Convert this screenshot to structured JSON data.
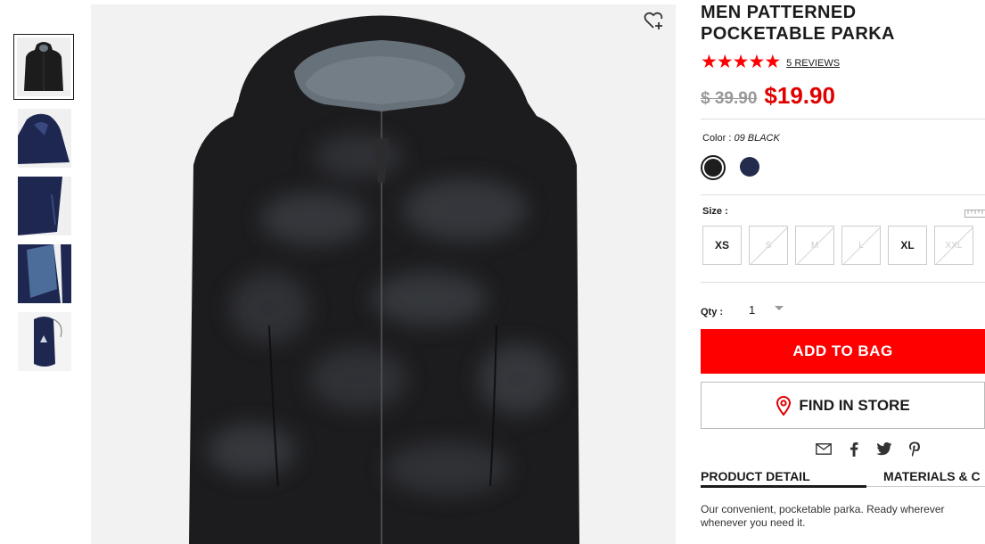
{
  "product": {
    "title": "MEN PATTERNED POCKETABLE PARKA",
    "rating_stars": 5,
    "reviews_label": "5 REVIEWS",
    "original_price": "$ 39.90",
    "sale_price": "$19.90"
  },
  "color": {
    "label": "Color :",
    "selected": "09 BLACK",
    "options": [
      {
        "name": "black",
        "hex": "#1e1e1e"
      },
      {
        "name": "navy",
        "hex": "#242c4d"
      }
    ]
  },
  "size": {
    "label": "Size :",
    "options": [
      {
        "label": "XS",
        "available": true
      },
      {
        "label": "S",
        "available": false
      },
      {
        "label": "M",
        "available": false
      },
      {
        "label": "L",
        "available": false
      },
      {
        "label": "XL",
        "available": true
      },
      {
        "label": "XXL",
        "available": false
      }
    ]
  },
  "quantity": {
    "label": "Qty :",
    "value": "1"
  },
  "actions": {
    "add_to_bag": "ADD TO BAG",
    "find_in_store": "FIND IN STORE"
  },
  "share_icons": [
    "mail-icon",
    "facebook-icon",
    "twitter-icon",
    "pinterest-icon"
  ],
  "tabs": [
    {
      "label": "PRODUCT DETAIL",
      "active": true
    },
    {
      "label": "MATERIALS & C",
      "active": false
    }
  ],
  "description": {
    "line1": "Our convenient, pocketable parka. Ready wherever",
    "line2": "whenever you need it."
  },
  "colors": {
    "accent": "#ff0000",
    "sale_price": "#e00000",
    "text": "#1b1b1b"
  }
}
